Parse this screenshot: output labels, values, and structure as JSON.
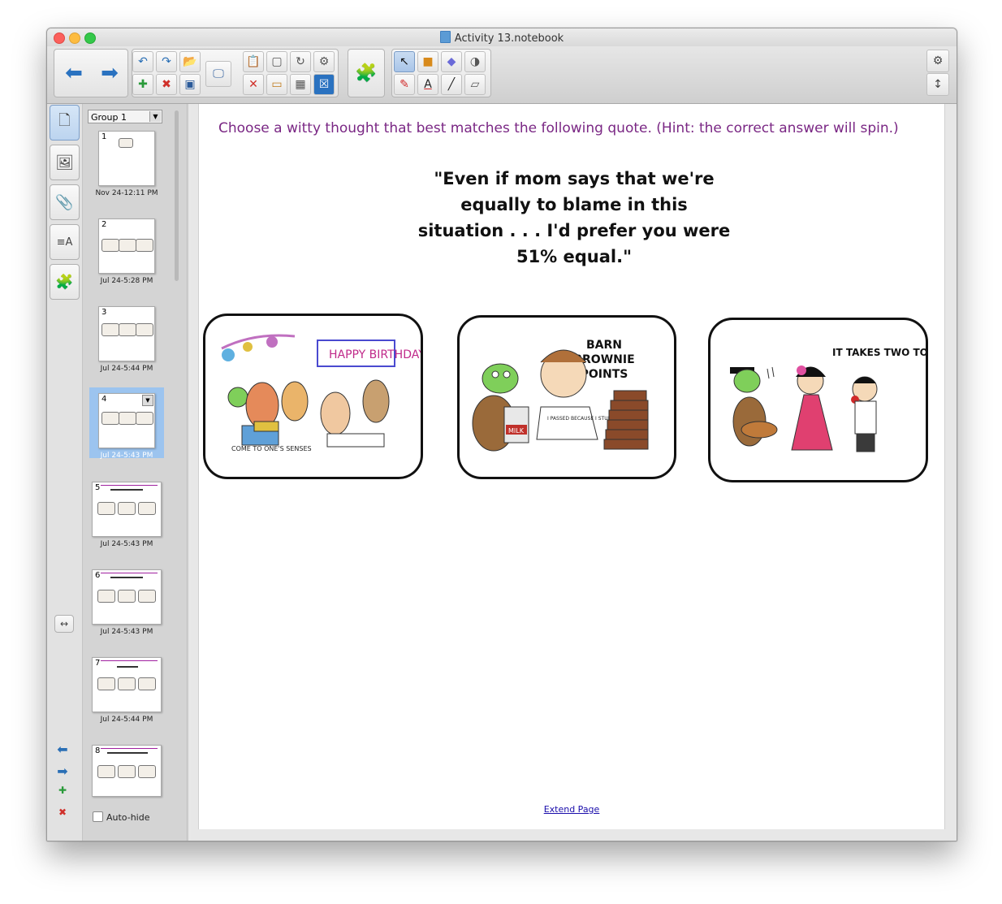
{
  "window": {
    "title": "Activity 13.notebook"
  },
  "toolbar": {
    "back_icon": "back-arrow-icon",
    "forward_icon": "forward-arrow-icon",
    "undo_icon": "undo-icon",
    "redo_icon": "redo-icon",
    "open_icon": "open-folder-icon",
    "add_page_icon": "add-page-icon",
    "delete_page_icon": "delete-page-icon",
    "save_icon": "save-icon"
  },
  "side_tabs": [
    "page-sorter-icon",
    "gallery-icon",
    "attachments-icon",
    "properties-icon",
    "addons-icon"
  ],
  "sorter": {
    "group_label": "Group 1",
    "autohide_label": "Auto-hide",
    "pages": [
      {
        "num": "1",
        "date": "Nov 24-12:11 PM"
      },
      {
        "num": "2",
        "date": "Jul 24-5:28 PM"
      },
      {
        "num": "3",
        "date": "Jul 24-5:44 PM"
      },
      {
        "num": "4",
        "date": "Jul 24-5:43 PM"
      },
      {
        "num": "5",
        "date": "Jul 24-5:43 PM"
      },
      {
        "num": "6",
        "date": "Jul 24-5:43 PM"
      },
      {
        "num": "7",
        "date": "Jul 24-5:44 PM"
      },
      {
        "num": "8",
        "date": ""
      }
    ]
  },
  "canvas": {
    "instruction": "Choose a witty thought that best matches the following quote.  (Hint: the correct answer will spin.)",
    "quote": "\"Even if mom says that we're equally to blame in this situation . . . I'd prefer you were 51% equal.\"",
    "extend_link": "Extend Page",
    "cards": [
      {
        "caption": "COME TO ONE'S SENSES",
        "banner": "HAPPY BIRTHDAY"
      },
      {
        "caption": "BARN BROWNIE POINTS",
        "note": "I PASSED BECAUSE I STUDIED A LOT",
        "carton": "MILK"
      },
      {
        "caption": "IT TAKES TWO TO TANGO"
      }
    ]
  }
}
